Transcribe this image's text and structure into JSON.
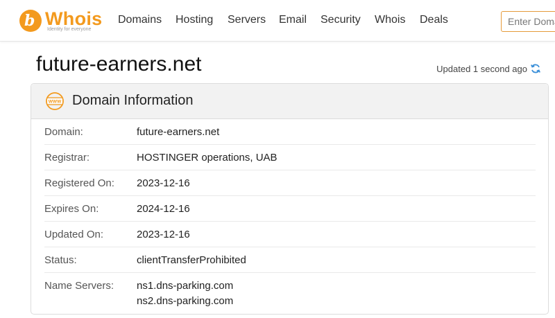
{
  "header": {
    "logo": {
      "word": "Whois",
      "tagline": "Identity for everyone"
    },
    "nav": [
      "Domains",
      "Hosting",
      "Servers",
      "Email",
      "Security",
      "Whois",
      "Deals"
    ],
    "search": {
      "placeholder": "Enter Domain or IP",
      "value": ""
    }
  },
  "page": {
    "domain_title": "future-earners.net",
    "updated": "Updated 1 second ago"
  },
  "card": {
    "icon": "www-icon",
    "title": "Domain Information",
    "rows": [
      {
        "label": "Domain:",
        "value": "future-earners.net"
      },
      {
        "label": "Registrar:",
        "value": "HOSTINGER operations, UAB"
      },
      {
        "label": "Registered On:",
        "value": "2023-12-16"
      },
      {
        "label": "Expires On:",
        "value": "2024-12-16"
      },
      {
        "label": "Updated On:",
        "value": "2023-12-16"
      },
      {
        "label": "Status:",
        "value": "clientTransferProhibited"
      },
      {
        "label": "Name Servers:",
        "value": "ns1.dns-parking.com",
        "value2": "ns2.dns-parking.com"
      }
    ]
  },
  "colors": {
    "brand": "#f39a1e",
    "refresh": "#3a8fd8"
  }
}
